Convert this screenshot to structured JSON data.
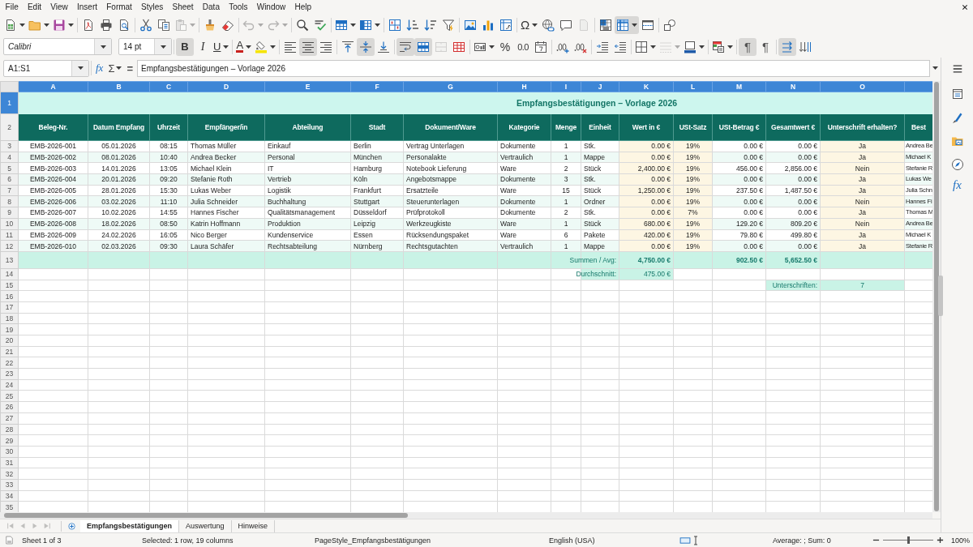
{
  "menu_bar": {
    "items": [
      "File",
      "Edit",
      "View",
      "Insert",
      "Format",
      "Styles",
      "Sheet",
      "Data",
      "Tools",
      "Window",
      "Help"
    ]
  },
  "standard_toolbar": [
    [
      {
        "pressed": false,
        "disabled": false
      },
      {
        "pressed": false,
        "disabled": false
      },
      {
        "pressed": false,
        "disabled": false
      }
    ],
    [
      {
        "pressed": false,
        "disabled": false
      },
      {
        "pressed": false,
        "disabled": false
      },
      {
        "pressed": false,
        "disabled": false
      }
    ],
    [
      {
        "pressed": false,
        "disabled": false
      },
      {
        "pressed": false,
        "disabled": false
      },
      {
        "pressed": false,
        "disabled": true
      }
    ],
    [
      {
        "pressed": false,
        "disabled": false
      },
      {
        "pressed": false,
        "disabled": false
      }
    ],
    [
      {
        "pressed": false,
        "disabled": true
      },
      {
        "pressed": false,
        "disabled": true
      }
    ],
    [
      {
        "pressed": false,
        "disabled": false
      },
      {
        "pressed": false,
        "disabled": false
      }
    ],
    [
      {
        "pressed": false,
        "disabled": false
      },
      {
        "pressed": false,
        "disabled": false
      }
    ],
    [
      {
        "pressed": false,
        "disabled": false
      },
      {
        "pressed": false,
        "disabled": false
      },
      {
        "pressed": false,
        "disabled": false
      },
      {
        "pressed": false,
        "disabled": false
      }
    ],
    [
      {
        "pressed": false,
        "disabled": false
      },
      {
        "pressed": false,
        "disabled": false
      },
      {
        "pressed": false,
        "disabled": false
      }
    ],
    [
      {
        "glyph": "Ω",
        "pressed": false,
        "disabled": false
      },
      {
        "pressed": false,
        "disabled": false
      },
      {
        "pressed": false,
        "disabled": false
      },
      {
        "pressed": false,
        "disabled": true
      }
    ],
    [
      {
        "pressed": false,
        "disabled": false
      },
      {
        "pressed": true,
        "disabled": false
      },
      {
        "pressed": false,
        "disabled": false
      }
    ],
    [
      {
        "pressed": false,
        "disabled": false
      }
    ]
  ],
  "formatting_toolbar": {
    "font_name": "Calibri",
    "font_size": "14 pt",
    "buttons": [
      [
        {
          "glyph": "B",
          "pressed": true,
          "disabled": false
        },
        {
          "glyph": "I",
          "pressed": false,
          "disabled": false
        },
        {
          "glyph": "U",
          "pressed": false,
          "disabled": false
        }
      ],
      [
        {
          "glyph": "A",
          "pressed": false,
          "disabled": false
        },
        {
          "pressed": false,
          "disabled": false
        }
      ],
      [
        {
          "pressed": false,
          "disabled": false
        },
        {
          "pressed": true,
          "disabled": false
        },
        {
          "pressed": false,
          "disabled": false
        }
      ],
      [
        {
          "pressed": false,
          "disabled": false
        },
        {
          "pressed": true,
          "disabled": false
        },
        {
          "pressed": false,
          "disabled": false
        }
      ],
      [
        {
          "pressed": true,
          "disabled": false
        },
        {
          "pressed": true,
          "disabled": false
        },
        {
          "pressed": false,
          "disabled": true
        },
        {
          "pressed": false,
          "disabled": false
        }
      ],
      [
        {
          "pressed": false,
          "disabled": false
        },
        {
          "glyph": "%",
          "pressed": false,
          "disabled": false
        },
        {
          "glyph": "0.0",
          "pressed": false,
          "disabled": false
        },
        {
          "pressed": false,
          "disabled": false
        }
      ],
      [
        {
          "pressed": false,
          "disabled": false
        },
        {
          "pressed": false,
          "disabled": false
        }
      ],
      [
        {
          "pressed": false,
          "disabled": false
        },
        {
          "pressed": false,
          "disabled": false
        }
      ],
      [
        {
          "pressed": false,
          "disabled": false
        },
        {
          "pressed": false,
          "disabled": true
        },
        {
          "pressed": false,
          "disabled": false
        }
      ],
      [
        {
          "pressed": false,
          "disabled": false
        }
      ],
      [
        {
          "glyph": "¶",
          "pressed": true,
          "disabled": false
        },
        {
          "glyph": "¶",
          "pressed": false,
          "disabled": false
        }
      ],
      [
        {
          "pressed": true,
          "disabled": false
        },
        {
          "pressed": false,
          "disabled": false
        }
      ]
    ]
  },
  "formula_bar": {
    "name_box": "A1:S1",
    "function_wizard": "fx",
    "sum": "Σ",
    "equals": "=",
    "formula": "Empfangsbestätigungen – Vorlage 2026"
  },
  "sidebar": {
    "functions_button": "fx"
  },
  "sheet": {
    "columns": [
      {
        "letter": "A",
        "heading": "Beleg-Nr.",
        "selected": true,
        "highlight": false
      },
      {
        "letter": "B",
        "heading": "Datum Empfang",
        "selected": true,
        "highlight": false
      },
      {
        "letter": "C",
        "heading": "Uhrzeit",
        "selected": true,
        "highlight": false
      },
      {
        "letter": "D",
        "heading": "Empfänger/in",
        "selected": true,
        "highlight": false
      },
      {
        "letter": "E",
        "heading": "Abteilung",
        "selected": true,
        "highlight": false
      },
      {
        "letter": "F",
        "heading": "Stadt",
        "selected": true,
        "highlight": false
      },
      {
        "letter": "G",
        "heading": "Dokument/Ware",
        "selected": true,
        "highlight": false
      },
      {
        "letter": "H",
        "heading": "Kategorie",
        "selected": true,
        "highlight": false
      },
      {
        "letter": "I",
        "heading": "Menge",
        "selected": true,
        "highlight": false
      },
      {
        "letter": "J",
        "heading": "Einheit",
        "selected": true,
        "highlight": false
      },
      {
        "letter": "K",
        "heading": "Wert in €",
        "selected": true,
        "highlight": true
      },
      {
        "letter": "L",
        "heading": "USt-Satz",
        "selected": true,
        "highlight": true
      },
      {
        "letter": "M",
        "heading": "USt-Betrag €",
        "selected": true,
        "highlight": false
      },
      {
        "letter": "N",
        "heading": "Gesamtwert €",
        "selected": true,
        "highlight": false
      },
      {
        "letter": "O",
        "heading": "Unterschrift erhalten?",
        "selected": true,
        "highlight": true
      },
      {
        "heading": "Best",
        "selected": true,
        "highlight": false
      }
    ],
    "row_headers": [
      {
        "label": "1",
        "selected": true
      },
      {
        "label": "2",
        "selected": false
      },
      {
        "label": "3",
        "selected": false
      },
      {
        "label": "4",
        "selected": false
      },
      {
        "label": "5",
        "selected": false
      },
      {
        "label": "6",
        "selected": false
      },
      {
        "label": "7",
        "selected": false
      },
      {
        "label": "8",
        "selected": false
      },
      {
        "label": "9",
        "selected": false
      },
      {
        "label": "10",
        "selected": false
      },
      {
        "label": "11",
        "selected": false
      },
      {
        "label": "12",
        "selected": false
      },
      {
        "label": "13",
        "selected": false
      },
      {
        "label": "14",
        "selected": false
      },
      {
        "label": "15",
        "selected": false
      },
      {
        "label": "16",
        "selected": false
      },
      {
        "label": "17",
        "selected": false
      },
      {
        "label": "18",
        "selected": false
      },
      {
        "label": "19",
        "selected": false
      },
      {
        "label": "20",
        "selected": false
      },
      {
        "label": "21",
        "selected": false
      },
      {
        "label": "22",
        "selected": false
      },
      {
        "label": "23",
        "selected": false
      },
      {
        "label": "24",
        "selected": false
      },
      {
        "label": "25",
        "selected": false
      },
      {
        "label": "26",
        "selected": false
      },
      {
        "label": "27",
        "selected": false
      },
      {
        "label": "28",
        "selected": false
      },
      {
        "label": "29",
        "selected": false
      },
      {
        "label": "30",
        "selected": false
      },
      {
        "label": "31",
        "selected": false
      },
      {
        "label": "32",
        "selected": false
      },
      {
        "label": "33",
        "selected": false
      },
      {
        "label": "34",
        "selected": false
      },
      {
        "label": "35",
        "selected": false
      }
    ],
    "title": "Empfangsbestätigungen – Vorlage 2026",
    "rows": [
      [
        "EMB-2026-001",
        "05.01.2026",
        "08:15",
        "Thomas Müller",
        "Einkauf",
        "Berlin",
        "Vertrag Unterlagen",
        "Dokumente",
        "1",
        "Stk.",
        "0.00 €",
        "19%",
        "0.00 €",
        "0.00 €",
        "Ja",
        "Andrea Be"
      ],
      [
        "EMB-2026-002",
        "08.01.2026",
        "10:40",
        "Andrea Becker",
        "Personal",
        "München",
        "Personalakte",
        "Vertraulich",
        "1",
        "Mappe",
        "0.00 €",
        "19%",
        "0.00 €",
        "0.00 €",
        "Ja",
        "Michael K"
      ],
      [
        "EMB-2026-003",
        "14.01.2026",
        "13:05",
        "Michael Klein",
        "IT",
        "Hamburg",
        "Notebook Lieferung",
        "Ware",
        "2",
        "Stück",
        "2,400.00 €",
        "19%",
        "456.00 €",
        "2,856.00 €",
        "Nein",
        "Stefanie R"
      ],
      [
        "EMB-2026-004",
        "20.01.2026",
        "09:20",
        "Stefanie Roth",
        "Vertrieb",
        "Köln",
        "Angebotsmappe",
        "Dokumente",
        "3",
        "Stk.",
        "0.00 €",
        "19%",
        "0.00 €",
        "0.00 €",
        "Ja",
        "Lukas We"
      ],
      [
        "EMB-2026-005",
        "28.01.2026",
        "15:30",
        "Lukas Weber",
        "Logistik",
        "Frankfurt",
        "Ersatzteile",
        "Ware",
        "15",
        "Stück",
        "1,250.00 €",
        "19%",
        "237.50 €",
        "1,487.50 €",
        "Ja",
        "Julia Schn"
      ],
      [
        "EMB-2026-006",
        "03.02.2026",
        "11:10",
        "Julia Schneider",
        "Buchhaltung",
        "Stuttgart",
        "Steuerunterlagen",
        "Dokumente",
        "1",
        "Ordner",
        "0.00 €",
        "19%",
        "0.00 €",
        "0.00 €",
        "Nein",
        "Hannes Fi"
      ],
      [
        "EMB-2026-007",
        "10.02.2026",
        "14:55",
        "Hannes Fischer",
        "Qualitätsmanagement",
        "Düsseldorf",
        "Prüfprotokoll",
        "Dokumente",
        "2",
        "Stk.",
        "0.00 €",
        "7%",
        "0.00 €",
        "0.00 €",
        "Ja",
        "Thomas M"
      ],
      [
        "EMB-2026-008",
        "18.02.2026",
        "08:50",
        "Katrin Hoffmann",
        "Produktion",
        "Leipzig",
        "Werkzeugkiste",
        "Ware",
        "1",
        "Stück",
        "680.00 €",
        "19%",
        "129.20 €",
        "809.20 €",
        "Nein",
        "Andrea Be"
      ],
      [
        "EMB-2026-009",
        "24.02.2026",
        "16:05",
        "Nico Berger",
        "Kundenservice",
        "Essen",
        "Rücksendungspaket",
        "Ware",
        "6",
        "Pakete",
        "420.00 €",
        "19%",
        "79.80 €",
        "499.80 €",
        "Ja",
        "Michael K"
      ],
      [
        "EMB-2026-010",
        "02.03.2026",
        "09:30",
        "Laura Schäfer",
        "Rechtsabteilung",
        "Nürnberg",
        "Rechtsgutachten",
        "Vertraulich",
        "1",
        "Mappe",
        "0.00 €",
        "19%",
        "0.00 €",
        "0.00 €",
        "Ja",
        "Stefanie R"
      ]
    ],
    "summary_rows": [
      {
        "kind": "band",
        "cells": [
          null,
          null,
          null,
          null,
          null,
          null,
          null,
          null,
          null,
          {
            "kind": "label",
            "text": "Summen / Avg:"
          },
          {
            "kind": "value",
            "text": "4,750.00 €"
          },
          null,
          {
            "kind": "value",
            "text": "902.50 €"
          },
          {
            "kind": "value",
            "text": "5,652.50 €"
          },
          null,
          null
        ]
      },
      {
        "kind": "plain",
        "cells": [
          null,
          null,
          null,
          null,
          null,
          null,
          null,
          null,
          null,
          {
            "kind": "label",
            "text": "Durchschnitt:"
          },
          {
            "kind": "value",
            "text": "475.00 €"
          },
          null,
          null,
          null,
          null,
          null
        ]
      },
      {
        "kind": "plain",
        "cells": [
          null,
          null,
          null,
          null,
          null,
          null,
          null,
          null,
          null,
          null,
          null,
          null,
          null,
          {
            "kind": "label",
            "text": "Unterschriften:"
          },
          {
            "kind": "value",
            "text": "7"
          },
          null
        ]
      }
    ]
  },
  "sheet_navigation": [
    {
      "disabled": true
    },
    {
      "disabled": true
    },
    {
      "disabled": true
    },
    {
      "disabled": true
    }
  ],
  "sheet_tabs": [
    {
      "label": "Empfangsbestätigungen",
      "selected": true
    },
    {
      "label": "Auswertung",
      "selected": false
    },
    {
      "label": "Hinweise",
      "selected": false
    }
  ],
  "status_bar": {
    "sheet": "Sheet 1 of 3",
    "selection": "Selected: 1 row, 19 columns",
    "page_style": "PageStyle_Empfangsbestätigungen",
    "language": "English (USA)",
    "summary": "Average: ; Sum: 0",
    "zoom_slider": {
      "level": 0.5
    },
    "zoom": "100%"
  }
}
